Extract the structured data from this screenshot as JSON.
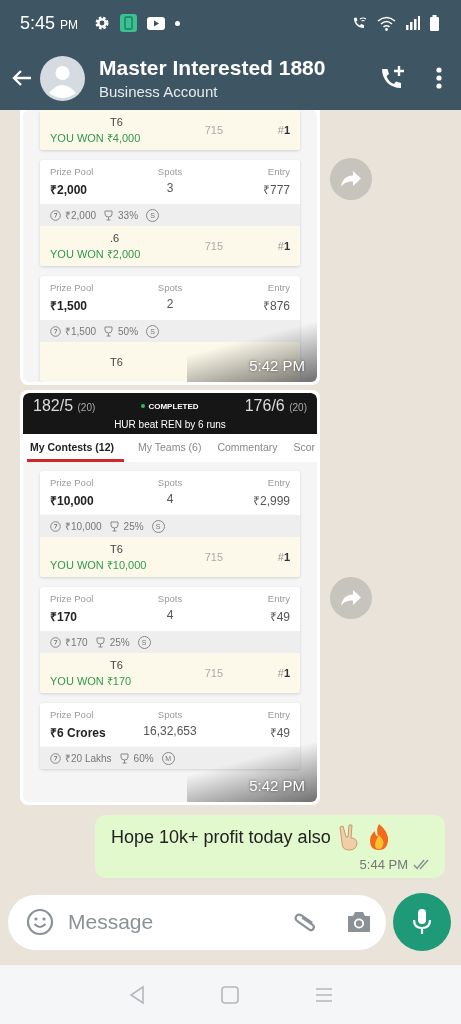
{
  "status_bar": {
    "time": "5:45",
    "meridiem": "PM"
  },
  "header": {
    "name": "Master Interested 1880",
    "subtitle": "Business Account"
  },
  "messages": [
    {
      "kind": "image",
      "time": "5:42 PM",
      "cards": [
        {
          "team": "T6",
          "result": "YOU WON ₹4,000",
          "points": "715",
          "rank": "#**1**"
        },
        {
          "labels": [
            "Prize Pool",
            "Spots",
            "Entry"
          ],
          "prize": "₹2,000",
          "spots": "3",
          "entry": "₹777",
          "bonus": "₹2,000",
          "winners": "33%",
          "badge": "S",
          "team": ".6",
          "result": "YOU WON ₹2,000",
          "points": "715",
          "rank": "#**1**"
        },
        {
          "labels": [
            "Prize Pool",
            "Spots",
            "Entry"
          ],
          "prize": "₹1,500",
          "spots": "2",
          "entry": "₹876",
          "bonus": "₹1,500",
          "winners": "50%",
          "badge": "S",
          "team": "T6"
        }
      ]
    },
    {
      "kind": "image",
      "time": "5:42 PM",
      "match": {
        "score_left": "182/5",
        "overs_left": "(20)",
        "status": "COMPLETED",
        "score_right": "176/6",
        "overs_right": "(20)",
        "result": "HUR beat REN by 6 runs"
      },
      "tabs": [
        {
          "label": "My Contests (12)",
          "selected": true
        },
        {
          "label": "My Teams (6)",
          "selected": false
        },
        {
          "label": "Commentary",
          "selected": false
        },
        {
          "label": "Scor",
          "selected": false
        }
      ],
      "cards": [
        {
          "labels": [
            "Prize Pool",
            "Spots",
            "Entry"
          ],
          "prize": "₹10,000",
          "spots": "4",
          "entry": "₹2,999",
          "bonus": "₹10,000",
          "winners": "25%",
          "badge": "S",
          "team": "T6",
          "result": "YOU WON ₹10,000",
          "points": "715",
          "rank": "#**1**"
        },
        {
          "labels": [
            "Prize Pool",
            "Spots",
            "Entry"
          ],
          "prize": "₹170",
          "spots": "4",
          "entry": "₹49",
          "bonus": "₹170",
          "winners": "25%",
          "badge": "S",
          "team": "T6",
          "result": "YOU WON ₹170",
          "points": "715",
          "rank": "#**1**"
        },
        {
          "labels": [
            "Prize Pool",
            "Spots",
            "Entry"
          ],
          "prize": "₹6 Crores",
          "spots": "16,32,653",
          "entry": "₹49",
          "bonus": "₹20 Lakhs",
          "winners": "60%",
          "badge": "M"
        }
      ]
    },
    {
      "kind": "text",
      "text": "Hope 10k+ profit today also",
      "time": "5:44 PM",
      "read": false
    }
  ],
  "composer": {
    "placeholder": "Message"
  }
}
